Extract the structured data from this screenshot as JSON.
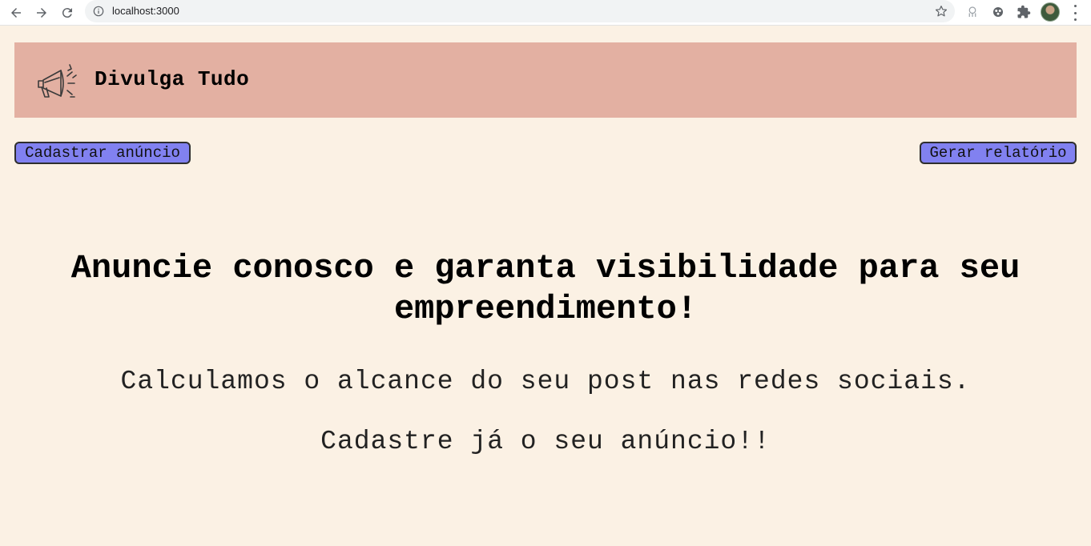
{
  "browser": {
    "url": "localhost:3000",
    "icons": [
      "back-arrow-icon",
      "forward-arrow-icon",
      "reload-icon",
      "info-icon",
      "bookmark-star-icon",
      "extension-icon",
      "puzzle-icon",
      "profile-avatar",
      "menu-dots-icon"
    ]
  },
  "header": {
    "brand": "Divulga Tudo",
    "logo_icon": "megaphone-icon",
    "background": "#e3b0a2"
  },
  "actions": {
    "register_label": "Cadastrar anúncio",
    "report_label": "Gerar relatório",
    "button_color": "#8181f0"
  },
  "hero": {
    "title": "Anuncie conosco e garanta visibilidade para seu empreendimento!",
    "subtitle_1": "Calculamos o alcance do seu post nas redes sociais.",
    "subtitle_2": "Cadastre já o seu anúncio!!"
  },
  "colors": {
    "page_background": "#fbf1e4"
  }
}
